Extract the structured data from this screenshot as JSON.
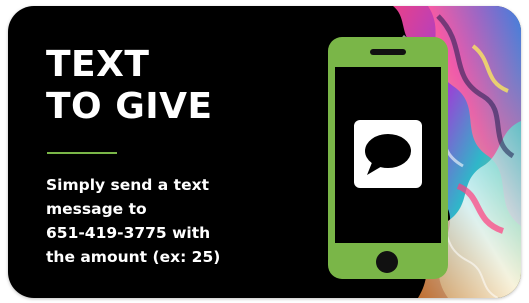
{
  "card": {
    "headline_line1": "TEXT",
    "headline_line2": "TO GIVE",
    "body_lines": [
      "Simply send a text",
      "message to",
      "651-419-3775 with",
      "the amount (ex: 25)"
    ]
  },
  "icons": {
    "phone": "smartphone-icon",
    "message": "speech-bubble-icon"
  },
  "colors": {
    "background": "#000000",
    "accent_green": "#7ab648",
    "text": "#ffffff"
  }
}
